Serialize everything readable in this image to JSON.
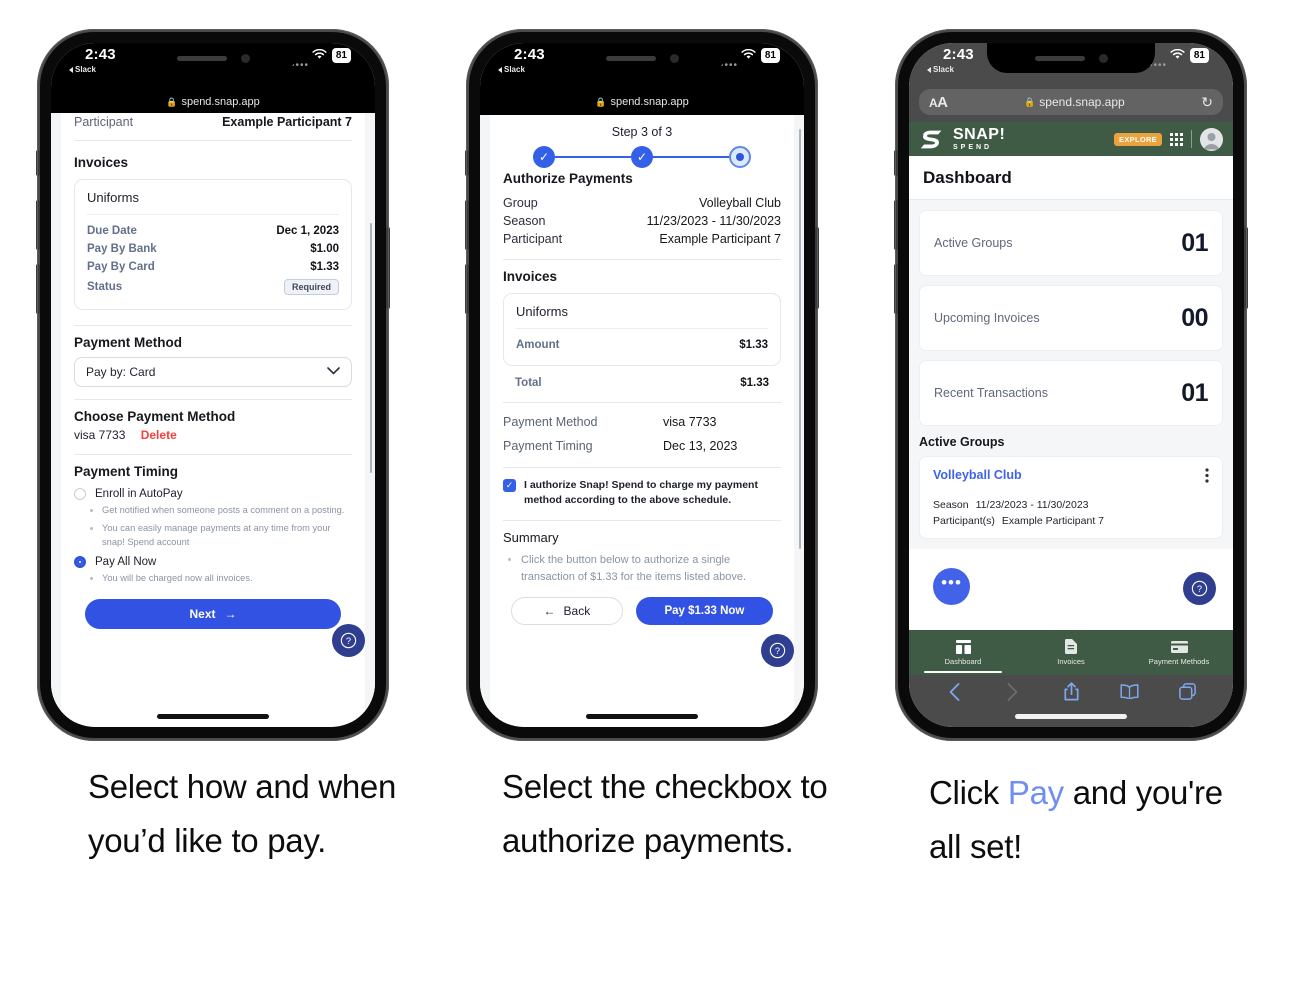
{
  "status_bar": {
    "time": "2:43",
    "back_app": "Slack",
    "battery": "81",
    "wifi_icon": "wifi-icon"
  },
  "phone1": {
    "url": "spend.snap.app",
    "top_row": {
      "label": "Participant",
      "value": "Example Participant 7"
    },
    "invoices_heading": "Invoices",
    "invoice": {
      "name": "Uniforms",
      "rows": [
        {
          "label": "Due Date",
          "value": "Dec 1, 2023"
        },
        {
          "label": "Pay By Bank",
          "value": "$1.00"
        },
        {
          "label": "Pay By Card",
          "value": "$1.33"
        }
      ],
      "status_label": "Status",
      "status_value": "Required"
    },
    "payment_method_heading": "Payment Method",
    "payment_method_select": "Pay by: Card",
    "choose_payment_heading": "Choose Payment Method",
    "saved_card": "visa 7733",
    "delete_label": "Delete",
    "payment_timing_heading": "Payment Timing",
    "options": [
      {
        "label": "Enroll in AutoPay",
        "selected": false,
        "bullets": [
          "Get notified when someone posts a comment on a posting.",
          "You can easily manage payments at any time from your snap! Spend account"
        ]
      },
      {
        "label": "Pay All Now",
        "selected": true,
        "bullets": [
          "You will be charged now all invoices."
        ]
      }
    ],
    "next_button": "Next",
    "next_arrow": "→",
    "help_icon": "?"
  },
  "phone2": {
    "url": "spend.snap.app",
    "step_label": "Step 3 of 3",
    "steps": [
      {
        "state": "done",
        "glyph": "✓"
      },
      {
        "state": "done",
        "glyph": "✓"
      },
      {
        "state": "current",
        "glyph": ""
      }
    ],
    "heading": "Authorize Payments",
    "details": [
      {
        "label": "Group",
        "value": "Volleyball Club"
      },
      {
        "label": "Season",
        "value": "11/23/2023 - 11/30/2023"
      },
      {
        "label": "Participant",
        "value": "Example Participant 7"
      }
    ],
    "invoices_heading": "Invoices",
    "invoice": {
      "name": "Uniforms",
      "amount_label": "Amount",
      "amount_value": "$1.33"
    },
    "total_label": "Total",
    "total_value": "$1.33",
    "meta": [
      {
        "label": "Payment Method",
        "value": "visa 7733"
      },
      {
        "label": "Payment Timing",
        "value": "Dec 13, 2023"
      }
    ],
    "authorize_checkbox": {
      "checked": true,
      "check_glyph": "✓",
      "text": "I authorize Snap! Spend to charge my payment method according to the above schedule."
    },
    "summary_heading": "Summary",
    "summary_bullets": [
      "Click the button below to authorize a single transaction of $1.33 for the items listed above."
    ],
    "back_button": "Back",
    "back_arrow": "←",
    "pay_button": "Pay $1.33 Now",
    "help_icon": "?"
  },
  "phone3": {
    "safari": {
      "aa_label_small": "A",
      "aa_label_big": "A",
      "url": "spend.snap.app",
      "reload_icon": "↻"
    },
    "brand": {
      "name": "SNAP!",
      "sub": "SPEND",
      "explore_label": "EXPLORE"
    },
    "page_title": "Dashboard",
    "stats": [
      {
        "label": "Active Groups",
        "value": "01"
      },
      {
        "label": "Upcoming Invoices",
        "value": "00"
      },
      {
        "label": "Recent Transactions",
        "value": "01"
      }
    ],
    "active_groups_heading": "Active Groups",
    "group": {
      "name": "Volleyball Club",
      "season_label": "Season",
      "season_value": "11/23/2023 - 11/30/2023",
      "participant_label": "Participant(s)",
      "participant_value": "Example Participant 7"
    },
    "tabs": [
      {
        "label": "Dashboard",
        "icon": "dashboard-icon",
        "active": true
      },
      {
        "label": "Invoices",
        "icon": "document-icon",
        "active": false
      },
      {
        "label": "Payment Methods",
        "icon": "credit-card-icon",
        "active": false
      }
    ],
    "safari_toolbar": [
      "back-icon",
      "forward-icon",
      "share-icon",
      "bookmarks-icon",
      "tabs-icon"
    ],
    "fab_dots": "•••",
    "help_icon": "?"
  },
  "captions": {
    "one": "Select how and when you’d like to pay.",
    "two": "Select the checkbox to authorize payments.",
    "three_pre": "Click ",
    "three_highlight": "Pay",
    "three_post": " and you're all set!"
  },
  "colors": {
    "blue": "#3252e3",
    "brand_green": "#3f5a45",
    "explore_orange": "#eaa33c",
    "delete_red": "#f2413b",
    "caption_highlight": "#6f8ff0"
  }
}
